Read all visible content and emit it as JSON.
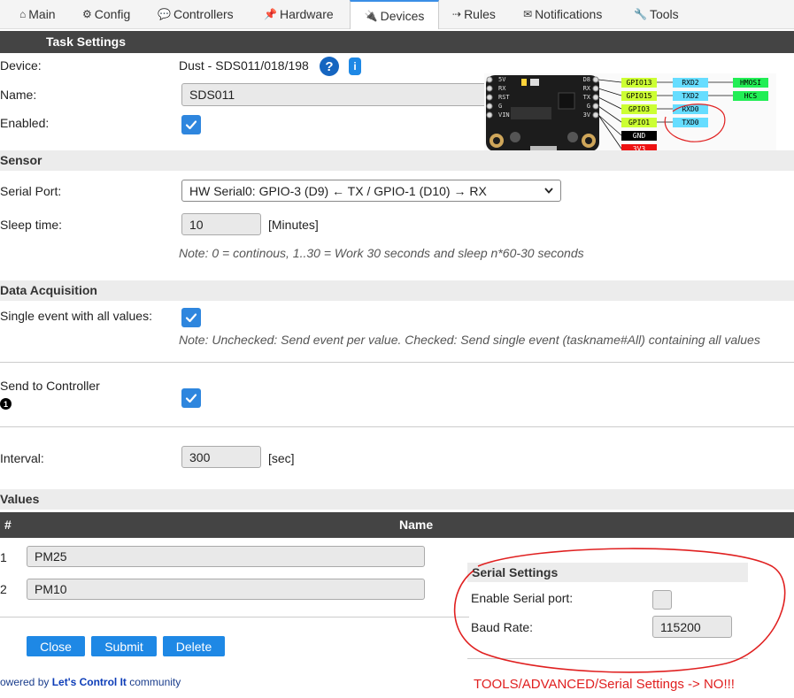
{
  "nav": {
    "tabs": [
      {
        "icon": "⌂",
        "label": "Main"
      },
      {
        "icon": "⚙",
        "label": "Config"
      },
      {
        "icon": "💬",
        "label": "Controllers"
      },
      {
        "icon": "📌",
        "label": "Hardware"
      },
      {
        "icon": "🔌",
        "label": "Devices"
      },
      {
        "icon": "⇢",
        "label": "Rules"
      },
      {
        "icon": "✉",
        "label": "Notifications"
      },
      {
        "icon": "🔧",
        "label": "Tools"
      }
    ]
  },
  "task": {
    "header": "Task Settings",
    "device_label": "Device:",
    "device_value": "Dust - SDS011/018/198",
    "help_icon": "?",
    "info_icon": "i",
    "name_label": "Name:",
    "name_value": "SDS011",
    "enabled_label": "Enabled:"
  },
  "board": {
    "left_pins": [
      "5V",
      "RX",
      "RST",
      "G",
      "VIN"
    ],
    "right_pins": [
      "D8",
      "RX",
      "TX",
      "G",
      "3V"
    ],
    "gpio_labels": [
      "GPIO13",
      "GPIO15",
      "GPIO3",
      "GPIO1",
      "GND",
      "3V3"
    ],
    "uart_labels": [
      "RXD2",
      "TXD2",
      "RXD0",
      "TXD0"
    ],
    "spi_labels": [
      "HMOSI",
      "HCS"
    ]
  },
  "sensor": {
    "header": "Sensor",
    "serial_label": "Serial Port:",
    "serial_value": "HW Serial0: GPIO-3 (D9) ← TX / GPIO-1 (D10) → RX",
    "sleep_label": "Sleep time:",
    "sleep_value": "10",
    "sleep_unit": "[Minutes]",
    "note": "Note: 0 = continous, 1..30 = Work 30 seconds and sleep n*60-30 seconds"
  },
  "acq": {
    "header": "Data Acquisition",
    "single_label": "Single event with all values:",
    "single_note": "Note: Unchecked: Send event per value. Checked: Send single event (taskname#All) containing all values",
    "send_label": "Send to Controller",
    "send_badge": "1",
    "interval_label": "Interval:",
    "interval_value": "300",
    "interval_unit": "[sec]"
  },
  "values": {
    "header": "Values",
    "col_num": "#",
    "col_name": "Name",
    "rows": [
      {
        "num": "1",
        "name": "PM25"
      },
      {
        "num": "2",
        "name": "PM10"
      }
    ]
  },
  "buttons": {
    "close": "Close",
    "submit": "Submit",
    "delete": "Delete"
  },
  "footer": {
    "prefix": "owered by",
    "brand": "Let's Control It",
    "suffix": " community"
  },
  "serial": {
    "header": "Serial Settings",
    "enable_label": "Enable Serial port:",
    "baud_label": "Baud Rate:",
    "baud_value": "115200"
  },
  "annotation": "TOOLS/ADVANCED/Serial Settings -> NO!!!",
  "colors": {
    "accent": "#1e88e5",
    "dark_bar": "#444444",
    "annotation": "#e02020",
    "gpio_green": "#ccff33",
    "uart_blue": "#66ddff",
    "spi_green": "#22ee55"
  }
}
